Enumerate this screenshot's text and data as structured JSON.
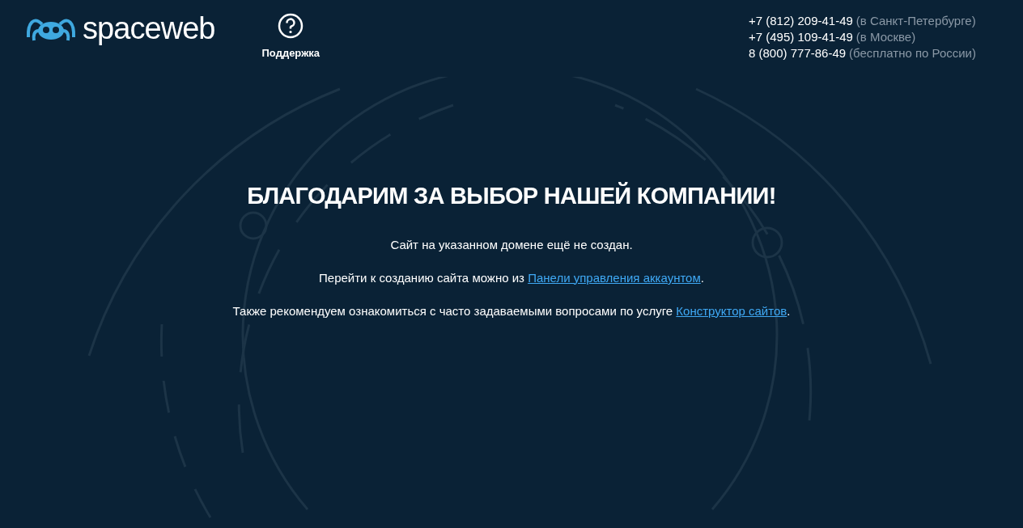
{
  "header": {
    "logo": "spaceweb",
    "support": "Поддержка",
    "phones": [
      {
        "number": "+7 (812) 209-41-49",
        "note": "(в Санкт-Петербурге)"
      },
      {
        "number": "+7 (495) 109-41-49",
        "note": "(в Москве)"
      },
      {
        "number": "8 (800) 777-86-49",
        "note": "(бесплатно по России)"
      }
    ]
  },
  "title": "БЛАГОДАРИМ ЗА ВЫБОР НАШЕЙ КОМПАНИИ!",
  "paragraphs": [
    {
      "text": "Сайт на указанном домене ещё не создан."
    },
    {
      "text": "Перейти к созданию сайта можно из ",
      "link": "Панели управления аккаунтом",
      "after": "."
    },
    {
      "text": "Также рекомендуем ознакомиться с часто задаваемыми вопросами по услуге ",
      "link": "Конструктор сайтов",
      "after": "."
    }
  ]
}
